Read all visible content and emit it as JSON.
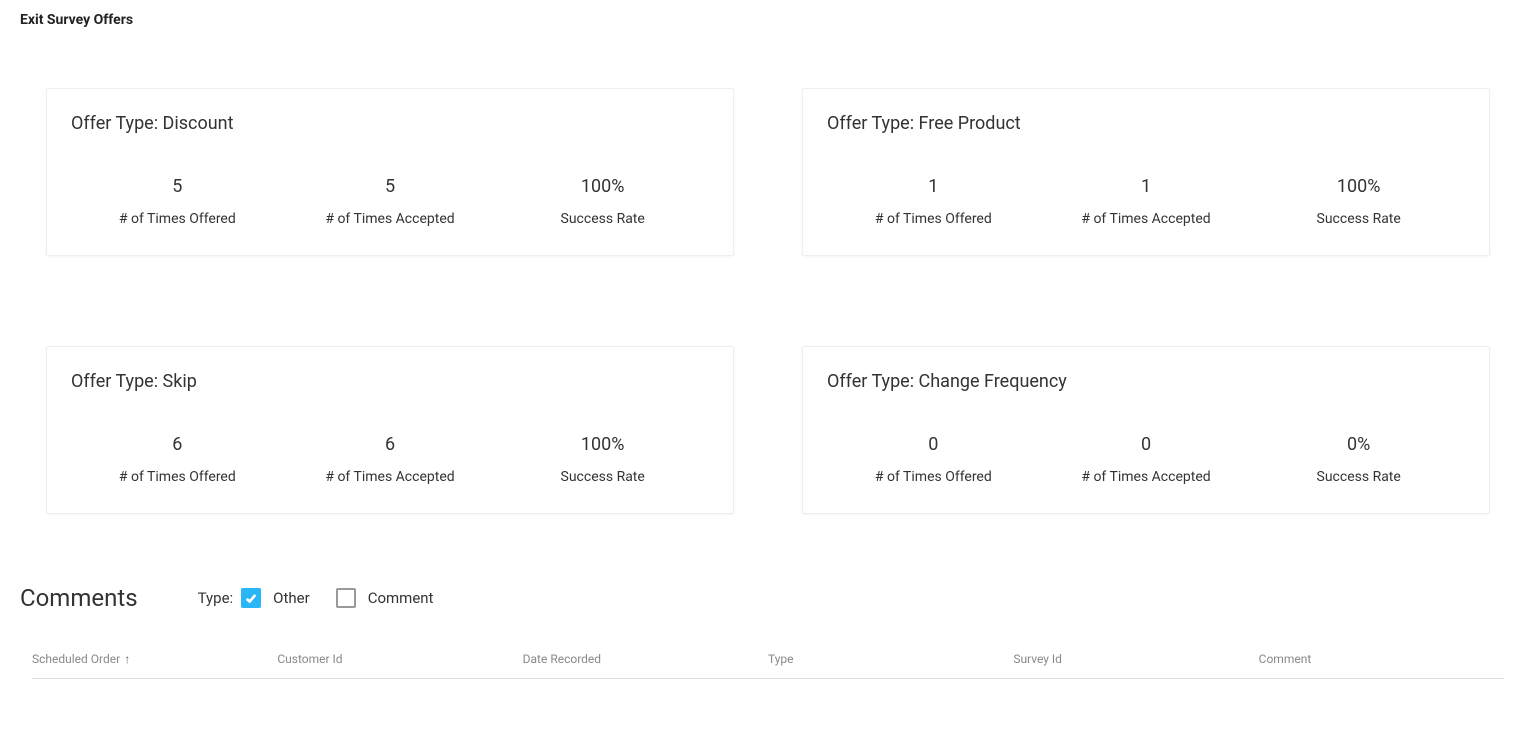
{
  "page_title": "Exit Survey Offers",
  "offer_type_prefix": "Offer Type: ",
  "stat_labels": {
    "offered": "# of Times Offered",
    "accepted": "# of Times Accepted",
    "success": "Success Rate"
  },
  "cards": [
    {
      "name": "Discount",
      "offered": "5",
      "accepted": "5",
      "success": "100%"
    },
    {
      "name": "Free Product",
      "offered": "1",
      "accepted": "1",
      "success": "100%"
    },
    {
      "name": "Skip",
      "offered": "6",
      "accepted": "6",
      "success": "100%"
    },
    {
      "name": "Change Frequency",
      "offered": "0",
      "accepted": "0",
      "success": "0%"
    }
  ],
  "comments": {
    "title": "Comments",
    "filter_label": "Type:",
    "options": [
      {
        "label": "Other",
        "checked": true
      },
      {
        "label": "Comment",
        "checked": false
      }
    ],
    "columns": [
      {
        "label": "Scheduled Order",
        "sorted": true
      },
      {
        "label": "Customer Id"
      },
      {
        "label": "Date Recorded"
      },
      {
        "label": "Type"
      },
      {
        "label": "Survey Id"
      },
      {
        "label": "Comment"
      }
    ]
  }
}
